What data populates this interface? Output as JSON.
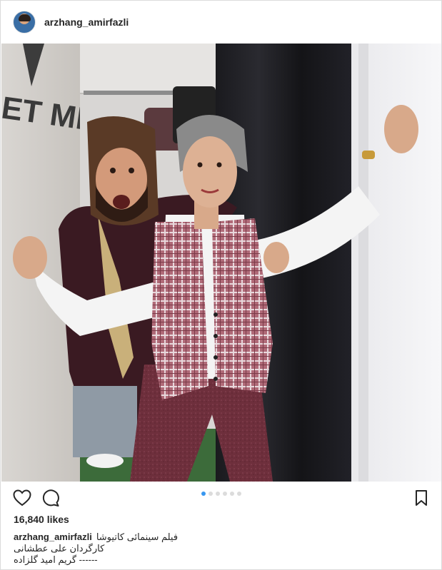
{
  "post": {
    "username": "arzhang_amirfazli",
    "likes": "16,840 likes",
    "carousel": {
      "count": 6,
      "active": 0
    },
    "caption": {
      "username": "arzhang_amirfazli",
      "line1": "فیلم سینمائی کاتیوشا",
      "line2": "کارگردان علی عطشانی",
      "line3": "------ گریم امید گلزاده"
    },
    "photo": {
      "sign_text": "ET MEN"
    }
  },
  "icons": {
    "like": "heart-icon",
    "comment": "comment-icon",
    "save": "bookmark-icon"
  },
  "colors": {
    "accent": "#3897f0",
    "text": "#262626",
    "border": "#dbdbdb"
  }
}
